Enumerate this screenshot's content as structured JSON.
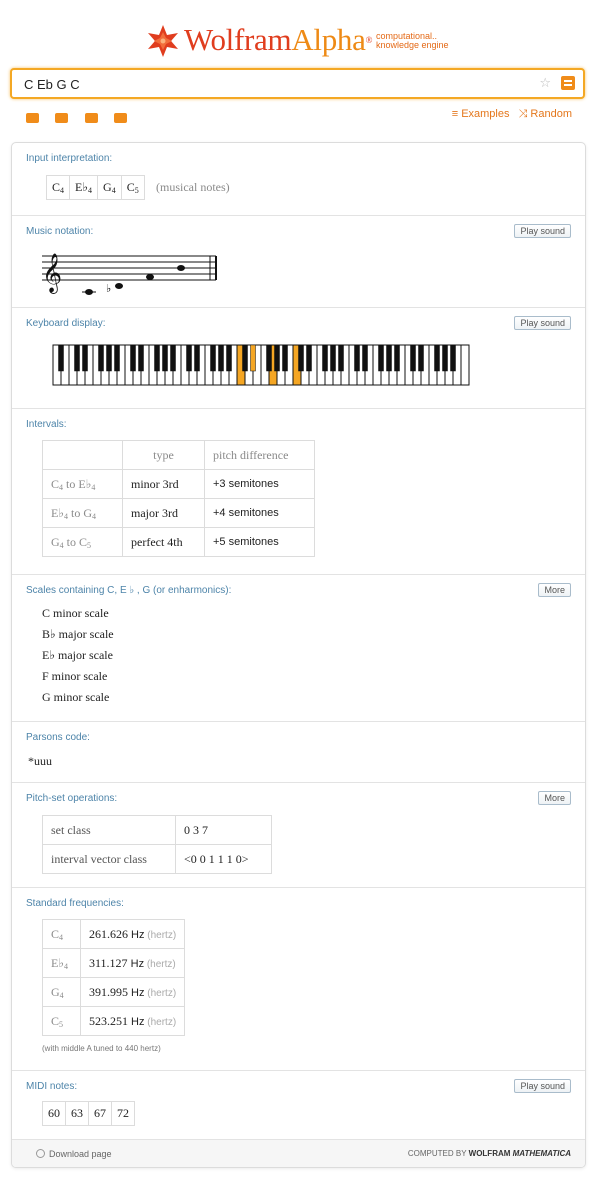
{
  "header": {
    "brand_first": "Wolfram",
    "brand_second": "Alpha",
    "tagline_line1": "computational..",
    "tagline_line2": "knowledge engine"
  },
  "search": {
    "value": "C Eb G C",
    "nav_examples": "≡ Examples",
    "nav_random": "⤨ Random"
  },
  "pods": {
    "input": {
      "title": "Input interpretation:",
      "notes": [
        {
          "letter": "C",
          "acc": "",
          "oct": "4"
        },
        {
          "letter": "E",
          "acc": "♭",
          "oct": "4"
        },
        {
          "letter": "G",
          "acc": "",
          "oct": "4"
        },
        {
          "letter": "C",
          "acc": "",
          "oct": "5"
        }
      ],
      "kind": "(musical notes)"
    },
    "notation": {
      "title": "Music notation:",
      "button": "Play sound"
    },
    "keyboard": {
      "title": "Keyboard display:",
      "button": "Play sound",
      "highlighted": [
        "C4",
        "Eb4",
        "G4",
        "C5"
      ]
    },
    "intervals": {
      "title": "Intervals:",
      "headers": [
        "type",
        "pitch difference"
      ],
      "rows": [
        {
          "from": "C",
          "from_acc": "",
          "from_oct": "4",
          "to_word": "to",
          "to": "E",
          "to_acc": "♭",
          "to_oct": "4",
          "type": "minor 3rd",
          "diff": "+3 semitones"
        },
        {
          "from": "E",
          "from_acc": "♭",
          "from_oct": "4",
          "to_word": "to",
          "to": "G",
          "to_acc": "",
          "to_oct": "4",
          "type": "major 3rd",
          "diff": "+4 semitones"
        },
        {
          "from": "G",
          "from_acc": "",
          "from_oct": "4",
          "to_word": "to",
          "to": "C",
          "to_acc": "",
          "to_oct": "5",
          "type": "perfect 4th",
          "diff": "+5 semitones"
        }
      ]
    },
    "scales": {
      "title": "Scales containing C, E ♭ , G (or enharmonics):",
      "button": "More",
      "items": [
        "C minor scale",
        "B♭ major scale",
        "E♭ major scale",
        "F minor scale",
        "G minor scale"
      ]
    },
    "parsons": {
      "title": "Parsons code:",
      "value": "*uuu"
    },
    "pitchset": {
      "title": "Pitch-set operations:",
      "button": "More",
      "rows": [
        {
          "label": "set class",
          "value": "0 3 7"
        },
        {
          "label": "interval vector class",
          "value": "<0 0 1 1 1 0>"
        }
      ]
    },
    "frequencies": {
      "title": "Standard frequencies:",
      "rows": [
        {
          "note": "C",
          "acc": "",
          "oct": "4",
          "value": "261.626",
          "unit": "Hz",
          "unit_name": "(hertz)"
        },
        {
          "note": "E",
          "acc": "♭",
          "oct": "4",
          "value": "311.127",
          "unit": "Hz",
          "unit_name": "(hertz)"
        },
        {
          "note": "G",
          "acc": "",
          "oct": "4",
          "value": "391.995",
          "unit": "Hz",
          "unit_name": "(hertz)"
        },
        {
          "note": "C",
          "acc": "",
          "oct": "5",
          "value": "523.251",
          "unit": "Hz",
          "unit_name": "(hertz)"
        }
      ],
      "note": "(with middle A tuned to 440 hertz)"
    },
    "midi": {
      "title": "MIDI notes:",
      "button": "Play sound",
      "values": [
        "60",
        "63",
        "67",
        "72"
      ]
    }
  },
  "footer": {
    "download": "Download page",
    "credit_prefix": "COMPUTED BY ",
    "credit_brand": "WOLFRAM",
    "credit_product": "MATHEMATICA"
  },
  "colors": {
    "brand": "#e03d1e",
    "accent": "#f08c1a",
    "pod_title": "#4d84a9",
    "key_highlight": "#f5a623"
  }
}
